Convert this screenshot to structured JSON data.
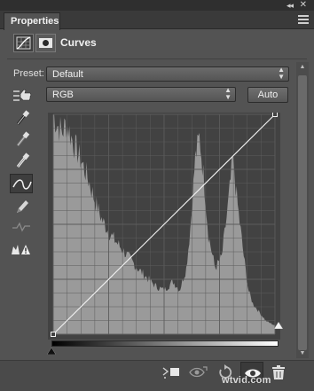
{
  "panel": {
    "tab_label": "Properties",
    "title": "Curves",
    "collapse_glyph": "◂◂",
    "close_glyph": "✕"
  },
  "preset": {
    "label": "Preset:",
    "value": "Default"
  },
  "channel": {
    "value": "RGB",
    "auto_label": "Auto"
  },
  "tools": [
    {
      "name": "on-image-adjust-icon"
    },
    {
      "name": "black-point-eyedropper-icon"
    },
    {
      "name": "gray-point-eyedropper-icon"
    },
    {
      "name": "white-point-eyedropper-icon"
    },
    {
      "name": "curve-points-icon",
      "selected": true
    },
    {
      "name": "pencil-icon"
    },
    {
      "name": "smooth-curve-icon"
    },
    {
      "name": "clipping-warning-icon"
    }
  ],
  "curve": {
    "input_range": [
      0,
      255
    ],
    "output_range": [
      0,
      255
    ],
    "points": [
      [
        0,
        0
      ],
      [
        255,
        255
      ]
    ]
  },
  "colors": {
    "panel_bg": "#535353",
    "graph_bg": "#424242",
    "histogram": "#9a9a9a",
    "grid": "#5c5c5c",
    "curve": "#f2f2f2"
  },
  "bottom_bar": {
    "buttons": [
      "clip-to-layer-icon",
      "view-previous-state-icon",
      "reset-icon",
      "visibility-eye-icon",
      "delete-trash-icon"
    ],
    "active": "visibility-eye-icon"
  },
  "watermark": "wtvid.com"
}
